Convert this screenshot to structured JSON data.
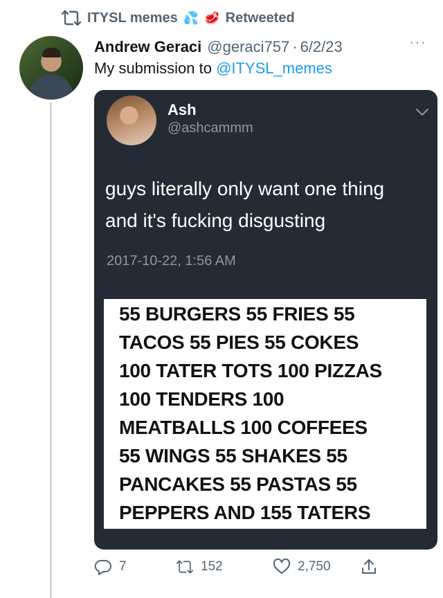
{
  "retweet_bar": {
    "text": "ITYSL memes",
    "emoji1": "💦",
    "emoji2": "🥩",
    "label": "Retweeted"
  },
  "tweet": {
    "author_name": "Andrew Geraci",
    "author_handle": "@geraci757",
    "separator": "·",
    "date": "6/2/23",
    "more_label": "···",
    "text_prefix": "My submission to ",
    "mention": "@ITYSL_memes"
  },
  "quoted": {
    "name": "Ash",
    "handle": "@ashcammm",
    "text_lines": [
      "guys literally only want one thing",
      "and it's fucking disgusting"
    ],
    "timestamp": "2017-10-22, 1:56 AM",
    "meme_lines": [
      "55 BURGERS 55 FRIES 55",
      "TACOS 55 PIES  55 COKES",
      "100 TATER TOTS 100 PIZZAS",
      "100 TENDERS 100",
      "MEATBALLS 100 COFFEES",
      "55 WINGS 55 SHAKES 55",
      "PANCAKES 55 PASTAS 55",
      "PEPPERS AND 155 TATERS"
    ]
  },
  "actions": {
    "replies": "7",
    "retweets": "152",
    "likes": "2,750"
  },
  "icons": {
    "retweet": "retweet-icon",
    "reply": "reply-icon",
    "like": "heart-icon",
    "share": "share-icon",
    "chevron": "chevron-down-icon"
  },
  "colors": {
    "accent": "#1d9bf0",
    "card_background": "#242b35",
    "muted": "#536471"
  }
}
